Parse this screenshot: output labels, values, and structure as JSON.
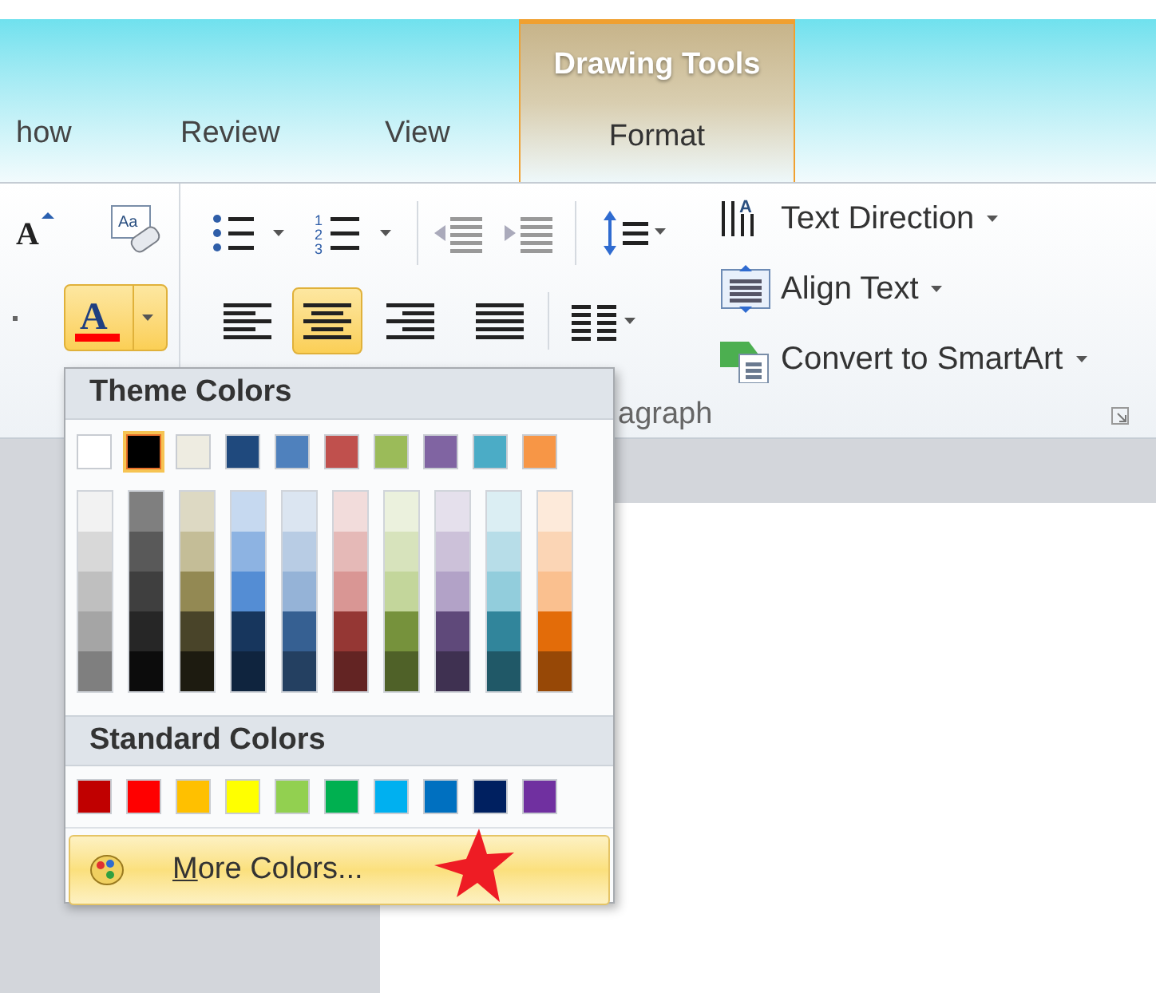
{
  "ribbon_tabs": {
    "contextual_header": "Drawing Tools",
    "tabs": [
      {
        "label": "how",
        "contextual": false
      },
      {
        "label": "Review",
        "contextual": false
      },
      {
        "label": "View",
        "contextual": false
      },
      {
        "label": "Format",
        "contextual": true
      }
    ]
  },
  "ribbon": {
    "icon_glyphs": {
      "grow_font": "A",
      "clear_formatting": "Aa",
      "font_color": "A",
      "numbering": [
        "1",
        "2",
        "3"
      ],
      "text_direction": "A"
    },
    "font_color_button": {
      "pressed": true,
      "color": "#ff0000"
    },
    "align_buttons": [
      {
        "kind": "left",
        "selected": false
      },
      {
        "kind": "center",
        "selected": true
      },
      {
        "kind": "right",
        "selected": false
      },
      {
        "kind": "justify",
        "selected": false
      }
    ],
    "commands": [
      {
        "kind": "text-direction",
        "label": "Text Direction"
      },
      {
        "kind": "align-text",
        "label": "Align Text"
      },
      {
        "kind": "smartart",
        "label": "Convert to SmartArt"
      }
    ],
    "group_label": "agraph"
  },
  "color_menu": {
    "theme_header": "Theme Colors",
    "theme_colors": [
      {
        "color": "#ffffff",
        "selected": false
      },
      {
        "color": "#000000",
        "selected": true
      },
      {
        "color": "#eeece1",
        "selected": false
      },
      {
        "color": "#1f497d",
        "selected": false
      },
      {
        "color": "#4f81bd",
        "selected": false
      },
      {
        "color": "#c0504d",
        "selected": false
      },
      {
        "color": "#9bbb59",
        "selected": false
      },
      {
        "color": "#8064a2",
        "selected": false
      },
      {
        "color": "#4bacc6",
        "selected": false
      },
      {
        "color": "#f79646",
        "selected": false
      }
    ],
    "shade_columns": [
      {
        "shades": [
          {
            "color": "#f2f2f2"
          },
          {
            "color": "#d8d8d8"
          },
          {
            "color": "#bfbfbf"
          },
          {
            "color": "#a5a5a5"
          },
          {
            "color": "#7f7f7f"
          }
        ]
      },
      {
        "shades": [
          {
            "color": "#7f7f7f"
          },
          {
            "color": "#595959"
          },
          {
            "color": "#3f3f3f"
          },
          {
            "color": "#262626"
          },
          {
            "color": "#0c0c0c"
          }
        ]
      },
      {
        "shades": [
          {
            "color": "#ddd9c3"
          },
          {
            "color": "#c4bd97"
          },
          {
            "color": "#938953"
          },
          {
            "color": "#494429"
          },
          {
            "color": "#1d1b10"
          }
        ]
      },
      {
        "shades": [
          {
            "color": "#c6d9f0"
          },
          {
            "color": "#8db3e2"
          },
          {
            "color": "#548dd4"
          },
          {
            "color": "#17365d"
          },
          {
            "color": "#0f243e"
          }
        ]
      },
      {
        "shades": [
          {
            "color": "#dbe5f1"
          },
          {
            "color": "#b8cce4"
          },
          {
            "color": "#95b3d7"
          },
          {
            "color": "#366092"
          },
          {
            "color": "#244061"
          }
        ]
      },
      {
        "shades": [
          {
            "color": "#f2dcdb"
          },
          {
            "color": "#e5b9b7"
          },
          {
            "color": "#d99694"
          },
          {
            "color": "#953734"
          },
          {
            "color": "#632423"
          }
        ]
      },
      {
        "shades": [
          {
            "color": "#ebf1dd"
          },
          {
            "color": "#d7e3bc"
          },
          {
            "color": "#c3d69b"
          },
          {
            "color": "#76923c"
          },
          {
            "color": "#4f6128"
          }
        ]
      },
      {
        "shades": [
          {
            "color": "#e5e0ec"
          },
          {
            "color": "#ccc1d9"
          },
          {
            "color": "#b2a2c7"
          },
          {
            "color": "#5f497a"
          },
          {
            "color": "#3f3151"
          }
        ]
      },
      {
        "shades": [
          {
            "color": "#dbeef3"
          },
          {
            "color": "#b7dde8"
          },
          {
            "color": "#92cddc"
          },
          {
            "color": "#31859b"
          },
          {
            "color": "#205867"
          }
        ]
      },
      {
        "shades": [
          {
            "color": "#fdeada"
          },
          {
            "color": "#fbd5b5"
          },
          {
            "color": "#fac08f"
          },
          {
            "color": "#e36c09"
          },
          {
            "color": "#974806"
          }
        ]
      }
    ],
    "standard_header": "Standard Colors",
    "standard_colors": [
      {
        "color": "#c00000"
      },
      {
        "color": "#ff0000"
      },
      {
        "color": "#ffc000"
      },
      {
        "color": "#ffff00"
      },
      {
        "color": "#92d050"
      },
      {
        "color": "#00b050"
      },
      {
        "color": "#00b0f0"
      },
      {
        "color": "#0070c0"
      },
      {
        "color": "#002060"
      },
      {
        "color": "#7030a0"
      }
    ],
    "more_colors": {
      "label": "More Colors...",
      "access_key_underlined": true
    }
  }
}
